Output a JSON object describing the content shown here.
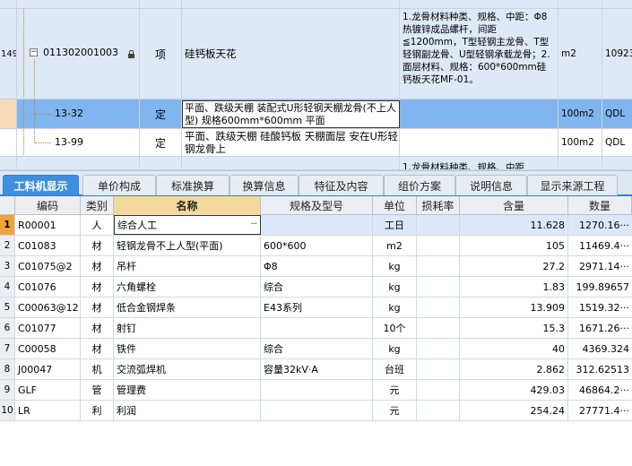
{
  "boq": {
    "main": {
      "row_number": "149",
      "expander": "−",
      "code": "011302001003",
      "type": "项",
      "name": "硅钙板天花",
      "features": "1.龙骨材料种类、规格、中距：Φ8热镀锌成品螺杆，间距≦1200mm，T型轻钢主龙骨、T型轻钢副龙骨、U型轻钢承载龙骨；2.面层材料、规格：600*600mm硅钙板天花MF-01。",
      "unit": "m2",
      "quantity": "10923"
    },
    "sub_rows": [
      {
        "code": "13-32",
        "type": "定",
        "name": "平面、跌级天棚 装配式U形轻钢天棚龙骨(不上人型) 规格600mm*600mm 平面",
        "unit": "100m2",
        "quantity": "QDL"
      },
      {
        "code": "13-99",
        "type": "定",
        "name": "平面、跌级天棚 硅酸钙板 天棚面层 安在U形轻钢龙骨上",
        "unit": "100m2",
        "quantity": "QDL"
      }
    ],
    "partial_next_features": "1.龙骨材料种类、规格、中距"
  },
  "tabs": [
    {
      "label": "工料机显示",
      "active": true
    },
    {
      "label": "单价构成",
      "active": false
    },
    {
      "label": "标准换算",
      "active": false
    },
    {
      "label": "换算信息",
      "active": false
    },
    {
      "label": "特征及内容",
      "active": false
    },
    {
      "label": "组价方案",
      "active": false
    },
    {
      "label": "说明信息",
      "active": false
    },
    {
      "label": "显示来源工程",
      "active": false
    }
  ],
  "materials": {
    "headers": {
      "code": "编码",
      "category": "类别",
      "name": "名称",
      "spec": "规格及型号",
      "unit": "单位",
      "loss": "损耗率",
      "content": "含量",
      "quantity": "数量"
    },
    "rows": [
      {
        "no": "1",
        "code": "R00001",
        "category": "人",
        "name": "综合人工",
        "spec": "",
        "unit": "工日",
        "loss": "",
        "content": "11.628",
        "quantity": "1270.16···"
      },
      {
        "no": "2",
        "code": "C01083",
        "category": "材",
        "name": "轻钢龙骨不上人型(平面)",
        "spec": "600*600",
        "unit": "m2",
        "loss": "",
        "content": "105",
        "quantity": "11469.4···"
      },
      {
        "no": "3",
        "code": "C01075@2",
        "category": "材",
        "name": "吊杆",
        "spec": "Φ8",
        "unit": "kg",
        "loss": "",
        "content": "27.2",
        "quantity": "2971.14···"
      },
      {
        "no": "4",
        "code": "C01076",
        "category": "材",
        "name": "六角螺栓",
        "spec": "综合",
        "unit": "kg",
        "loss": "",
        "content": "1.83",
        "quantity": "199.89657"
      },
      {
        "no": "5",
        "code": "C00063@12",
        "category": "材",
        "name": "低合金钢焊条",
        "spec": "E43系列",
        "unit": "kg",
        "loss": "",
        "content": "13.909",
        "quantity": "1519.32···"
      },
      {
        "no": "6",
        "code": "C01077",
        "category": "材",
        "name": "射钉",
        "spec": "",
        "unit": "10个",
        "loss": "",
        "content": "15.3",
        "quantity": "1671.26···"
      },
      {
        "no": "7",
        "code": "C00058",
        "category": "材",
        "name": "铁件",
        "spec": "综合",
        "unit": "kg",
        "loss": "",
        "content": "40",
        "quantity": "4369.324"
      },
      {
        "no": "8",
        "code": "J00047",
        "category": "机",
        "name": "交流弧焊机",
        "spec": "容量32kV·A",
        "unit": "台班",
        "loss": "",
        "content": "2.862",
        "quantity": "312.62513"
      },
      {
        "no": "9",
        "code": "GLF",
        "category": "管",
        "name": "管理费",
        "spec": "",
        "unit": "元",
        "loss": "",
        "content": "429.03",
        "quantity": "46864.2···"
      },
      {
        "no": "10",
        "code": "LR",
        "category": "利",
        "name": "利润",
        "spec": "",
        "unit": "元",
        "loss": "",
        "content": "254.24",
        "quantity": "27771.4···"
      }
    ]
  },
  "colors": {
    "selected_row": "#80b5ef",
    "active_tab": "#3f8fde",
    "name_header": "#f5d99c"
  }
}
